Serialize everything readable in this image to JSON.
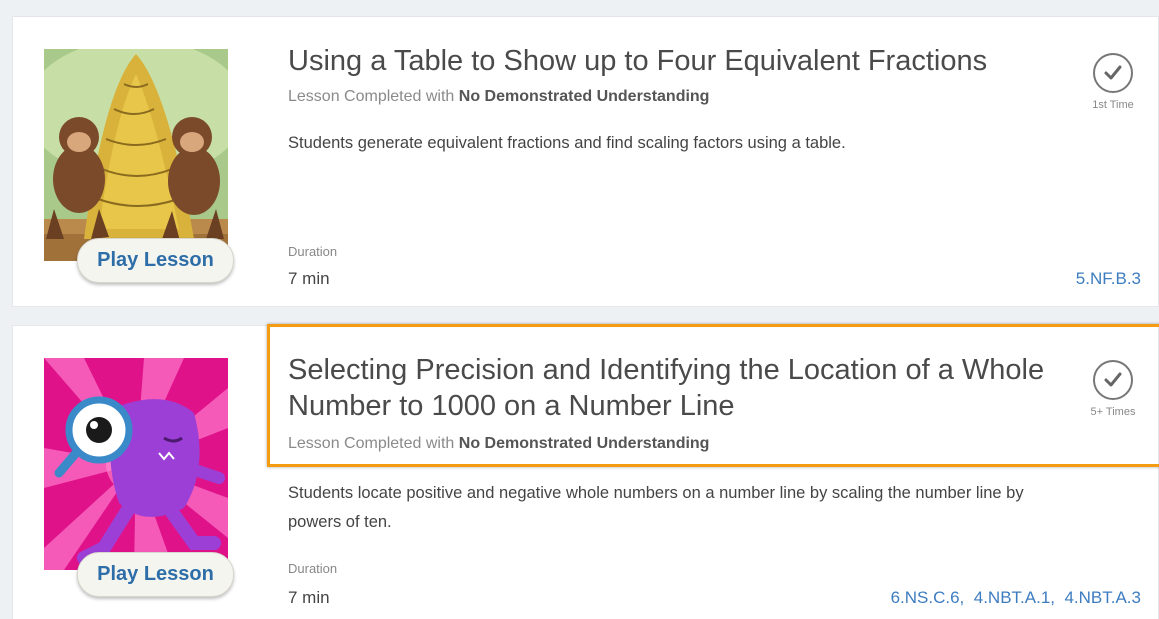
{
  "lessons": [
    {
      "title": "Using a Table to Show up to Four Equivalent Fractions",
      "status_prefix": "Lesson Completed with ",
      "status_value": "No Demonstrated Understanding",
      "description": "Students generate equivalent fractions and find scaling factors using a table.",
      "duration_label": "Duration",
      "duration_value": "7 min",
      "play_label": "Play Lesson",
      "completion_caption": "1st Time",
      "completion_icon": "checkmark-circle-icon",
      "thumbnail": "monkeys-bananas-image",
      "standards": [
        "5.NF.B.3"
      ]
    },
    {
      "title_line1": "Selecting Precision and Identifying the Location of a Whole",
      "title_line2": "Number to 1000 on a Number Line",
      "status_prefix": "Lesson Completed with ",
      "status_value": "No Demonstrated Understanding",
      "description_line1": "Students locate positive and negative whole numbers on a number line by scaling the number line by",
      "description_line2": "powers of ten.",
      "duration_label": "Duration",
      "duration_value": "7 min",
      "play_label": "Play Lesson",
      "completion_caption": "5+ Times",
      "completion_icon": "checkmark-circle-icon",
      "thumbnail": "purple-monster-magnifier-image",
      "standards": [
        "6.NS.C.6,",
        "4.NBT.A.1,",
        "4.NBT.A.3"
      ]
    }
  ],
  "colors": {
    "link": "#3d7cc0",
    "highlight": "#f39c12",
    "play_text": "#2e6ea8"
  }
}
